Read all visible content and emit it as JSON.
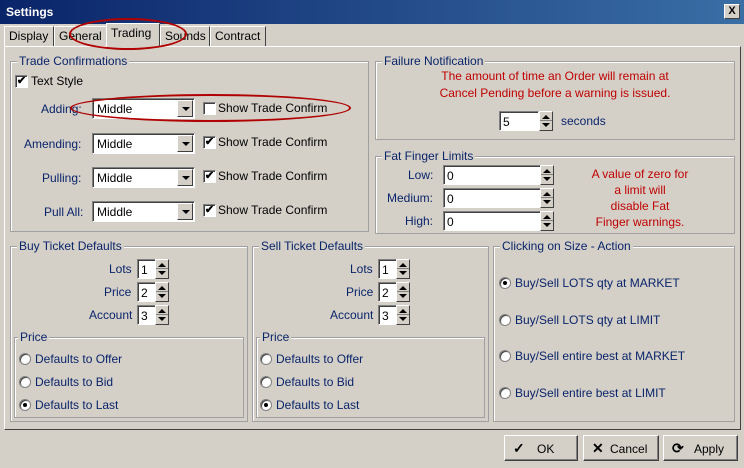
{
  "window": {
    "title": "Settings",
    "close_glyph": "X"
  },
  "tabs": [
    "Display",
    "General",
    "Trading",
    "Sounds",
    "Contract"
  ],
  "trade_confirmations": {
    "title": "Trade Confirmations",
    "text_style_label": "Text Style",
    "text_style_checked": true,
    "rows": [
      {
        "label": "Adding:",
        "value": "Middle",
        "confirm_label": "Show Trade Confirm",
        "checked": false
      },
      {
        "label": "Amending:",
        "value": "Middle",
        "confirm_label": "Show Trade Confirm",
        "checked": true
      },
      {
        "label": "Pulling:",
        "value": "Middle",
        "confirm_label": "Show Trade Confirm",
        "checked": true
      },
      {
        "label": "Pull All:",
        "value": "Middle",
        "confirm_label": "Show Trade Confirm",
        "checked": true
      }
    ]
  },
  "failure_notification": {
    "title": "Failure Notification",
    "message_line1": "The amount of time an Order will remain at",
    "message_line2": "Cancel Pending before a warning is issued.",
    "value": "5",
    "unit": "seconds"
  },
  "fat_finger": {
    "title": "Fat Finger Limits",
    "low_label": "Low:",
    "low_value": "0",
    "medium_label": "Medium:",
    "medium_value": "0",
    "high_label": "High:",
    "high_value": "0",
    "note_line1": "A value of zero for",
    "note_line2": "a limit will",
    "note_line3": "disable Fat",
    "note_line4": "Finger warnings."
  },
  "buy_ticket": {
    "title": "Buy Ticket Defaults",
    "lots_label": "Lots",
    "lots_value": "1",
    "price_label": "Price",
    "price_value": "2",
    "account_label": "Account",
    "account_value": "3",
    "price_group_title": "Price",
    "options": [
      "Defaults to Offer",
      "Defaults to Bid",
      "Defaults to Last"
    ],
    "selected": "Defaults to Last"
  },
  "sell_ticket": {
    "title": "Sell Ticket Defaults",
    "lots_label": "Lots",
    "lots_value": "1",
    "price_label": "Price",
    "price_value": "2",
    "account_label": "Account",
    "account_value": "3",
    "price_group_title": "Price",
    "options": [
      "Defaults to Offer",
      "Defaults to Bid",
      "Defaults to Last"
    ],
    "selected": "Defaults to Last"
  },
  "clicking_on_size": {
    "title": "Clicking on Size - Action",
    "options": [
      "Buy/Sell LOTS qty at MARKET",
      "Buy/Sell LOTS qty at LIMIT",
      "Buy/Sell entire best at MARKET",
      "Buy/Sell entire best at LIMIT"
    ],
    "selected": "Buy/Sell LOTS qty at MARKET"
  },
  "buttons": {
    "ok": "OK",
    "cancel": "Cancel",
    "apply": "Apply"
  },
  "colors": {
    "title_bar": "#0a246a",
    "label": "#0a246a",
    "warning_text": "#c00000",
    "highlight_ellipse": "#b00000"
  },
  "icons": {
    "ok": "checkmark-icon",
    "cancel": "x-icon",
    "apply": "refresh-icon"
  }
}
